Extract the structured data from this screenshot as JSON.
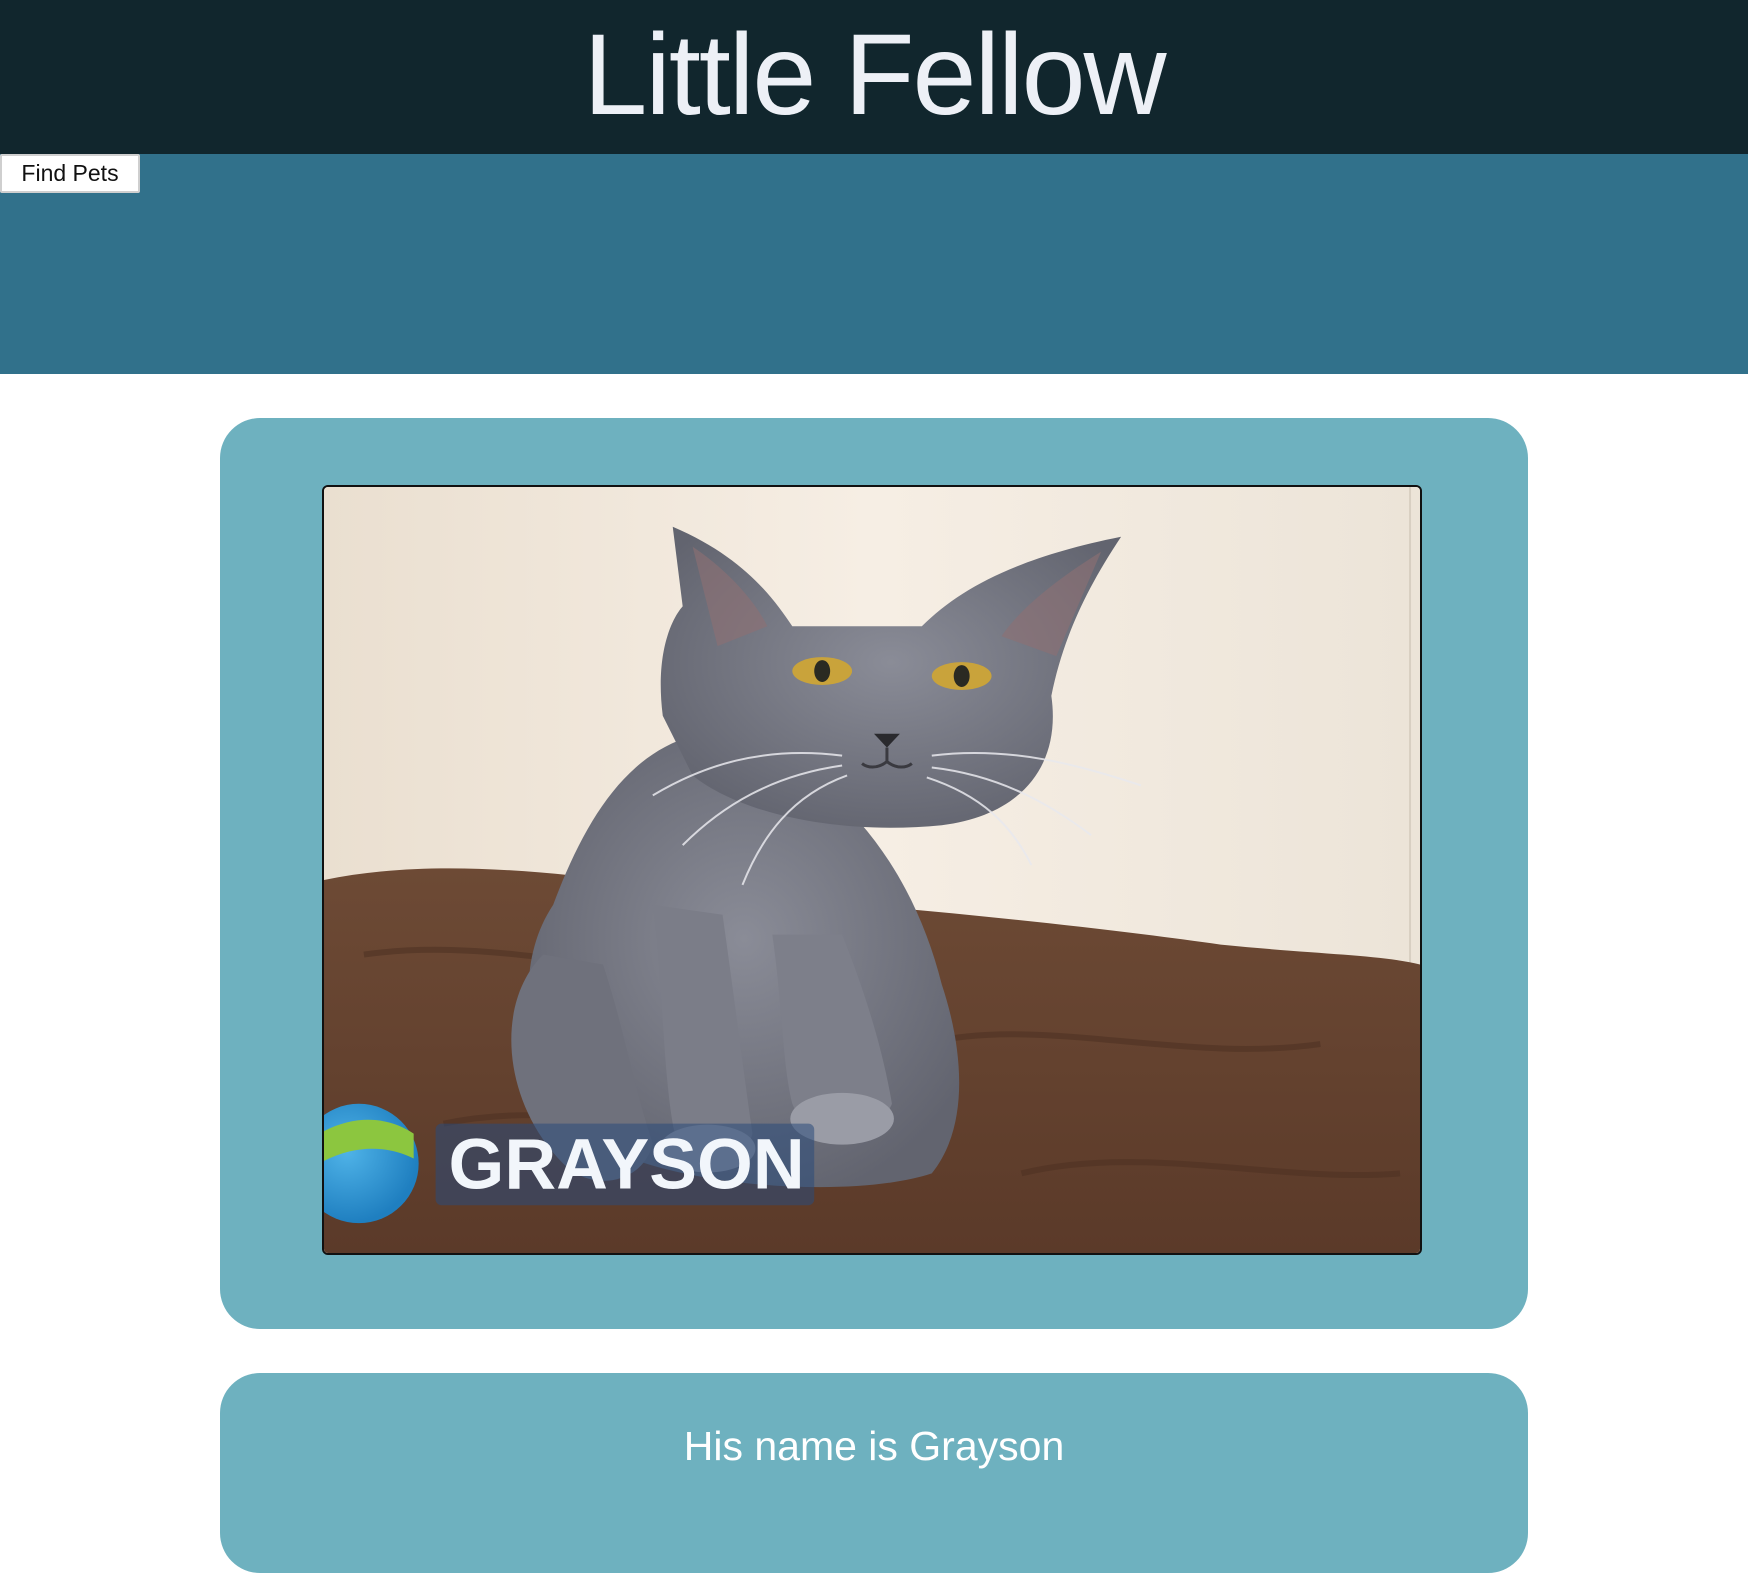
{
  "header": {
    "title": "Little Fellow"
  },
  "nav": {
    "find_pets_label": "Find Pets"
  },
  "pet": {
    "photo_caption": "GRAYSON",
    "intro_text": "His name is Grayson"
  },
  "colors": {
    "header_bg": "#11262d",
    "nav_bg": "#31718b",
    "card_bg": "#6eb1bf"
  }
}
